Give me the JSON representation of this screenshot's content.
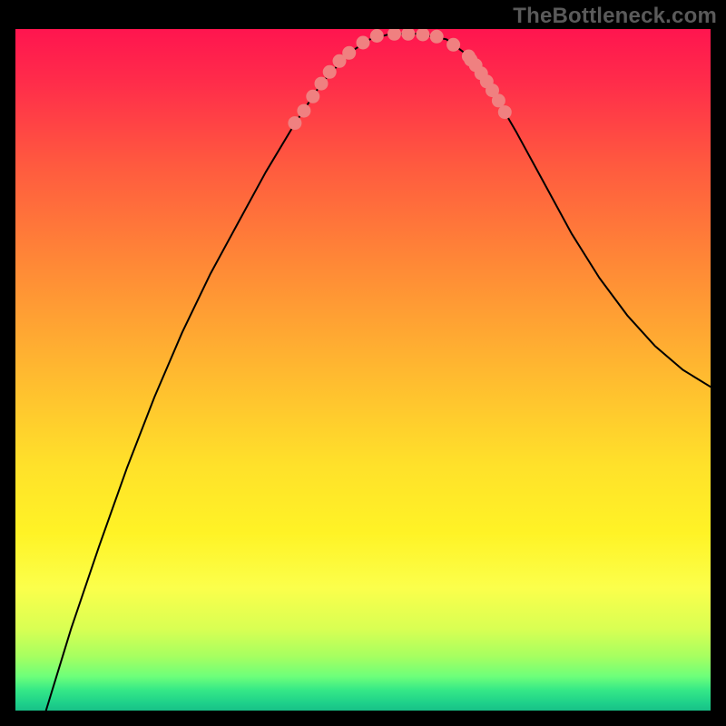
{
  "watermark": "TheBottleneck.com",
  "chart_data": {
    "type": "line",
    "title": "",
    "xlabel": "",
    "ylabel": "",
    "series": [
      {
        "name": "curve",
        "stroke": "#000000",
        "stroke_width": 2,
        "points": [
          {
            "x": 0.044,
            "y": 0.0
          },
          {
            "x": 0.08,
            "y": 0.12
          },
          {
            "x": 0.12,
            "y": 0.24
          },
          {
            "x": 0.16,
            "y": 0.355
          },
          {
            "x": 0.2,
            "y": 0.46
          },
          {
            "x": 0.24,
            "y": 0.555
          },
          {
            "x": 0.28,
            "y": 0.64
          },
          {
            "x": 0.32,
            "y": 0.715
          },
          {
            "x": 0.36,
            "y": 0.79
          },
          {
            "x": 0.4,
            "y": 0.858
          },
          {
            "x": 0.44,
            "y": 0.92
          },
          {
            "x": 0.48,
            "y": 0.965
          },
          {
            "x": 0.51,
            "y": 0.985
          },
          {
            "x": 0.54,
            "y": 0.993
          },
          {
            "x": 0.58,
            "y": 0.993
          },
          {
            "x": 0.62,
            "y": 0.985
          },
          {
            "x": 0.65,
            "y": 0.962
          },
          {
            "x": 0.68,
            "y": 0.92
          },
          {
            "x": 0.72,
            "y": 0.85
          },
          {
            "x": 0.76,
            "y": 0.775
          },
          {
            "x": 0.8,
            "y": 0.7
          },
          {
            "x": 0.84,
            "y": 0.635
          },
          {
            "x": 0.88,
            "y": 0.58
          },
          {
            "x": 0.92,
            "y": 0.535
          },
          {
            "x": 0.96,
            "y": 0.5
          },
          {
            "x": 1.0,
            "y": 0.475
          }
        ]
      },
      {
        "name": "tick-dots",
        "fill": "#f08080",
        "r": 7.5,
        "points": [
          {
            "x": 0.402,
            "y": 0.862
          },
          {
            "x": 0.415,
            "y": 0.88
          },
          {
            "x": 0.428,
            "y": 0.901
          },
          {
            "x": 0.44,
            "y": 0.92
          },
          {
            "x": 0.452,
            "y": 0.937
          },
          {
            "x": 0.466,
            "y": 0.953
          },
          {
            "x": 0.48,
            "y": 0.965
          },
          {
            "x": 0.5,
            "y": 0.98
          },
          {
            "x": 0.52,
            "y": 0.99
          },
          {
            "x": 0.545,
            "y": 0.993
          },
          {
            "x": 0.565,
            "y": 0.993
          },
          {
            "x": 0.586,
            "y": 0.992
          },
          {
            "x": 0.606,
            "y": 0.989
          },
          {
            "x": 0.63,
            "y": 0.977
          },
          {
            "x": 0.652,
            "y": 0.96
          },
          {
            "x": 0.655,
            "y": 0.955
          },
          {
            "x": 0.662,
            "y": 0.947
          },
          {
            "x": 0.67,
            "y": 0.935
          },
          {
            "x": 0.678,
            "y": 0.923
          },
          {
            "x": 0.686,
            "y": 0.91
          },
          {
            "x": 0.695,
            "y": 0.895
          },
          {
            "x": 0.704,
            "y": 0.878
          }
        ]
      }
    ],
    "xlim": [
      0,
      1
    ],
    "ylim": [
      0,
      1
    ],
    "background_gradient": {
      "direction": "vertical",
      "stops": [
        {
          "pos": 0.0,
          "color": "#ff154f"
        },
        {
          "pos": 0.5,
          "color": "#ffb830"
        },
        {
          "pos": 0.74,
          "color": "#fff326"
        },
        {
          "pos": 0.95,
          "color": "#6dff7a"
        },
        {
          "pos": 1.0,
          "color": "#18c087"
        }
      ]
    }
  },
  "colors": {
    "frame": "#000000",
    "watermark": "#5a5a5a",
    "dot": "#f08080"
  }
}
